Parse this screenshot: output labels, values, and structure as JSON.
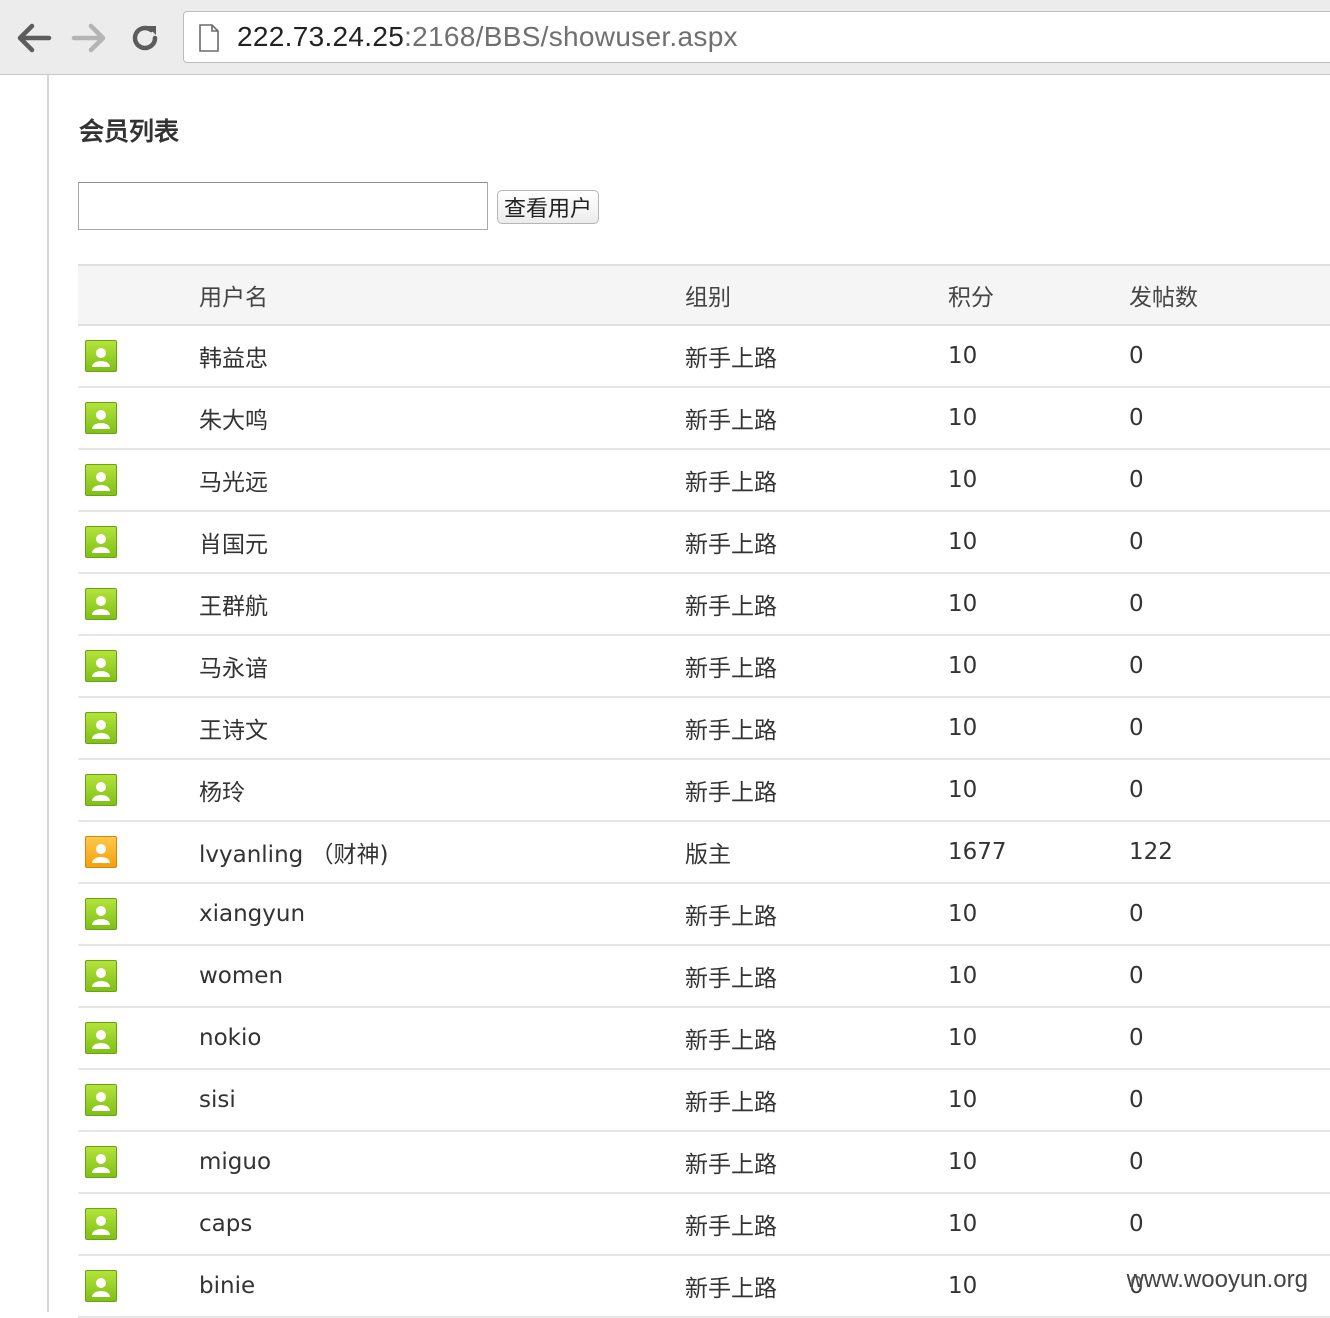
{
  "browser": {
    "url_host": "222.73.24.25",
    "url_rest": ":2168/BBS/showuser.aspx",
    "back_icon": "back-arrow-icon",
    "forward_icon": "forward-arrow-icon",
    "reload_icon": "reload-icon",
    "page_icon": "page-icon"
  },
  "page": {
    "title": "会员列表",
    "search_value": "",
    "search_button": "查看用户"
  },
  "table": {
    "headers": [
      "",
      "用户名",
      "组别",
      "积分",
      "发帖数"
    ],
    "rows": [
      {
        "avatar": "green",
        "name": "韩益忠",
        "group": "新手上路",
        "score": "10",
        "posts": "0"
      },
      {
        "avatar": "green",
        "name": "朱大鸣",
        "group": "新手上路",
        "score": "10",
        "posts": "0"
      },
      {
        "avatar": "green",
        "name": "马光远",
        "group": "新手上路",
        "score": "10",
        "posts": "0"
      },
      {
        "avatar": "green",
        "name": "肖国元",
        "group": "新手上路",
        "score": "10",
        "posts": "0"
      },
      {
        "avatar": "green",
        "name": "王群航",
        "group": "新手上路",
        "score": "10",
        "posts": "0"
      },
      {
        "avatar": "green",
        "name": "马永谙",
        "group": "新手上路",
        "score": "10",
        "posts": "0"
      },
      {
        "avatar": "green",
        "name": "王诗文",
        "group": "新手上路",
        "score": "10",
        "posts": "0"
      },
      {
        "avatar": "green",
        "name": "杨玲",
        "group": "新手上路",
        "score": "10",
        "posts": "0"
      },
      {
        "avatar": "orange",
        "name": "lvyanling （财神)",
        "group": "版主",
        "score": "1677",
        "posts": "122"
      },
      {
        "avatar": "green",
        "name": "xiangyun",
        "group": "新手上路",
        "score": "10",
        "posts": "0"
      },
      {
        "avatar": "green",
        "name": "women",
        "group": "新手上路",
        "score": "10",
        "posts": "0"
      },
      {
        "avatar": "green",
        "name": "nokio",
        "group": "新手上路",
        "score": "10",
        "posts": "0"
      },
      {
        "avatar": "green",
        "name": "sisi",
        "group": "新手上路",
        "score": "10",
        "posts": "0"
      },
      {
        "avatar": "green",
        "name": "miguo",
        "group": "新手上路",
        "score": "10",
        "posts": "0"
      },
      {
        "avatar": "green",
        "name": "caps",
        "group": "新手上路",
        "score": "10",
        "posts": "0"
      },
      {
        "avatar": "green",
        "name": "binie",
        "group": "新手上路",
        "score": "10",
        "posts": "0"
      }
    ]
  },
  "watermark": "www.wooyun.org",
  "colors": {
    "avatar_green": "#8fcf1e",
    "avatar_orange": "#f7a81b"
  }
}
